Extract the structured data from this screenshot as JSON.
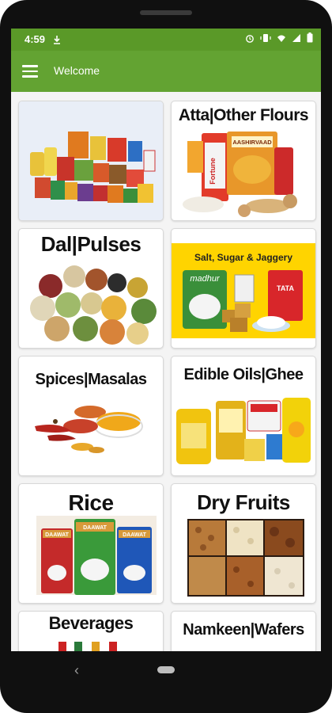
{
  "status_bar": {
    "time": "4:59"
  },
  "app_bar": {
    "title": "Welcome"
  },
  "categories": [
    {
      "label": ""
    },
    {
      "label": "Atta|Other Flours"
    },
    {
      "label": "Dal|Pulses"
    },
    {
      "label": "Salt, Sugar & Jaggery"
    },
    {
      "label": "Spices|Masalas"
    },
    {
      "label": "Edible Oils|Ghee"
    },
    {
      "label": "Rice"
    },
    {
      "label": "Dry Fruits"
    },
    {
      "label": "Beverages"
    },
    {
      "label": "Namkeen|Wafers"
    }
  ],
  "product_text": {
    "madhur": "madhur",
    "tata": "TATA",
    "daawat": "DAAWAT",
    "fortune": "Fortune",
    "aashirvaad": "AASHIRVAAD"
  },
  "colors": {
    "status_bar": "#5a9928",
    "app_bar": "#63a332"
  }
}
